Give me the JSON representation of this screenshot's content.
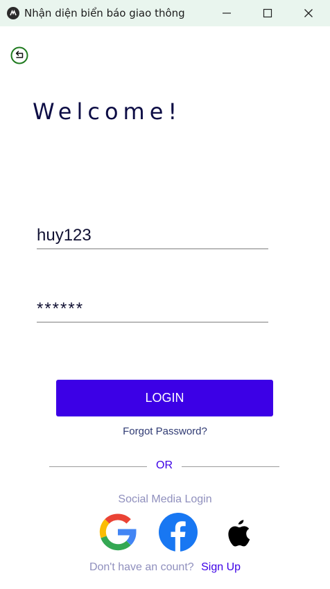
{
  "window": {
    "title": "Nhận diện biển báo giao thông",
    "buttons": [
      "minimize",
      "maximize",
      "close"
    ]
  },
  "header": {
    "back_icon": "back-arrow-icon",
    "welcome": "Welcome!"
  },
  "form": {
    "username_value": "huy123",
    "password_value": "******",
    "login_label": "LOGIN",
    "forgot_label": "Forgot Password?"
  },
  "divider": {
    "label": "OR"
  },
  "social": {
    "label": "Social Media Login",
    "providers": [
      "google-icon",
      "facebook-icon",
      "apple-icon"
    ]
  },
  "signup": {
    "prompt": "Don't have an count?",
    "link": "Sign Up"
  },
  "colors": {
    "accent": "#3c00e6",
    "title_text": "#0d0d45",
    "muted_text": "#8f8fbd",
    "titlebar_bg": "#e9f5ee"
  }
}
